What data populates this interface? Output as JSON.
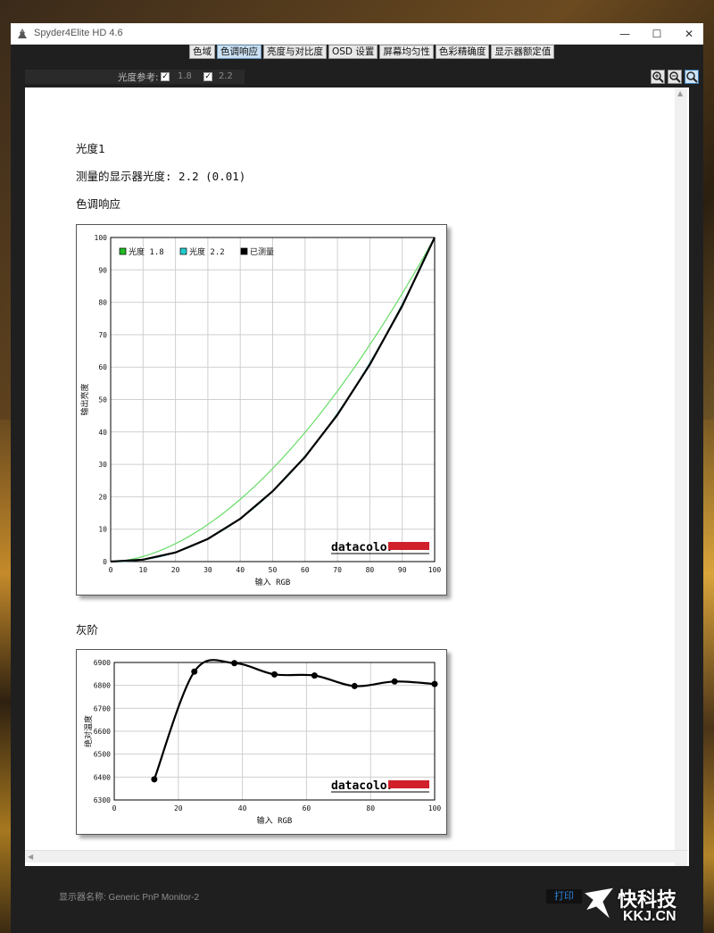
{
  "window": {
    "title": "Spyder4Elite HD 4.6",
    "minimize_glyph": "—",
    "maximize_glyph": "☐",
    "close_glyph": "✕"
  },
  "tabs": [
    {
      "label": "色域"
    },
    {
      "label": "色调响应"
    },
    {
      "label": "亮度与对比度"
    },
    {
      "label": "OSD 设置"
    },
    {
      "label": "屏幕均匀性"
    },
    {
      "label": "色彩精确度"
    },
    {
      "label": "显示器额定值"
    }
  ],
  "toolbar": {
    "reference_label": "光度参考:",
    "ref1": {
      "checked": true,
      "value": "1.8"
    },
    "ref2": {
      "checked": true,
      "value": "2.2"
    },
    "zoom_in_icon": "zoom-in-icon",
    "zoom_out_icon": "zoom-out-icon",
    "zoom_fit_icon": "zoom-fit-icon"
  },
  "report": {
    "section_title": "光度1",
    "measured_gamma_line": "测量的显示器光度:  2.2 (0.01)",
    "tone_response_title": "色调响应",
    "grayscale_title": "灰阶"
  },
  "chart_data": [
    {
      "type": "line",
      "title": "",
      "xlabel": "输入 RGB",
      "ylabel": "输出亮度",
      "xlim": [
        0,
        100
      ],
      "ylim": [
        0,
        100
      ],
      "x_ticks": [
        0,
        10,
        20,
        30,
        40,
        50,
        60,
        70,
        80,
        90,
        100
      ],
      "y_ticks": [
        0,
        10,
        20,
        30,
        40,
        50,
        60,
        70,
        80,
        90,
        100
      ],
      "grid": true,
      "legend_position": "top-left",
      "legend": [
        {
          "name": "光度 1.8",
          "color": "#22bb22"
        },
        {
          "name": "光度 2.2",
          "color": "#22cccc"
        },
        {
          "name": "已测量",
          "color": "#000000"
        }
      ],
      "series": [
        {
          "name": "光度 1.8",
          "color": "#66dd66",
          "gamma": 1.8,
          "x": [
            0,
            10,
            20,
            30,
            40,
            50,
            60,
            70,
            80,
            90,
            100
          ],
          "y": [
            0,
            1.6,
            5.5,
            11.5,
            19.2,
            28.7,
            39.9,
            52.6,
            66.9,
            82.7,
            100
          ]
        },
        {
          "name": "光度 2.2",
          "color": "#22aaaa",
          "gamma": 2.2,
          "x": [
            0,
            10,
            20,
            30,
            40,
            50,
            60,
            70,
            80,
            90,
            100
          ],
          "y": [
            0,
            0.6,
            2.9,
            7.1,
            13.3,
            21.8,
            32.5,
            45.6,
            61.2,
            79.3,
            100
          ]
        },
        {
          "name": "已测量",
          "color": "#000000",
          "x": [
            0,
            10,
            20,
            30,
            40,
            50,
            60,
            70,
            80,
            90,
            100
          ],
          "y": [
            0,
            0.6,
            2.8,
            7.0,
            13.2,
            21.7,
            32.3,
            45.3,
            60.8,
            78.9,
            100
          ]
        }
      ],
      "logo": {
        "text": "datacolor",
        "bar_color": "#d0202a"
      }
    },
    {
      "type": "line",
      "title": "",
      "xlabel": "输入 RGB",
      "ylabel": "绝对温度",
      "xlim": [
        0,
        100
      ],
      "ylim": [
        6300,
        6900
      ],
      "x_ticks": [
        0,
        20,
        40,
        60,
        80,
        100
      ],
      "y_ticks": [
        6300,
        6400,
        6500,
        6600,
        6700,
        6800,
        6900
      ],
      "grid": true,
      "series": [
        {
          "name": "",
          "color": "#000000",
          "x": [
            12.5,
            25,
            37.5,
            50,
            62.5,
            75,
            87.5,
            100
          ],
          "y": [
            6390,
            6860,
            6897,
            6848,
            6843,
            6797,
            6817,
            6806
          ]
        }
      ],
      "logo": {
        "text": "datacolor",
        "bar_color": "#d0202a"
      }
    }
  ],
  "status": {
    "monitor_name": "显示器名称: Generic PnP Monitor-2",
    "print_label": "打印"
  },
  "watermark": {
    "text_cn": "快科技",
    "text_en": "KKJ.CN"
  }
}
